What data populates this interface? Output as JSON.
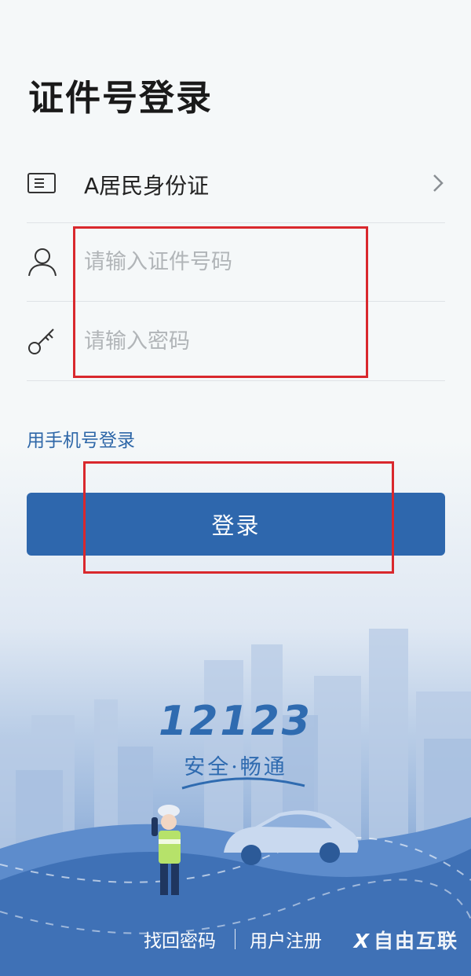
{
  "title": "证件号登录",
  "id_type": {
    "label": "A居民身份证"
  },
  "id_number": {
    "placeholder": "请输入证件号码"
  },
  "password": {
    "placeholder": "请输入密码"
  },
  "phone_login_link": "用手机号登录",
  "login_button": "登录",
  "brand": {
    "number": "12123",
    "slogan": "安全·畅通"
  },
  "footer": {
    "forgot_password": "找回密码",
    "register": "用户注册"
  },
  "watermark": {
    "symbol": "X",
    "text": "自由互联"
  },
  "icons": {
    "id_card": "id-card-icon",
    "user": "user-icon",
    "key": "key-icon",
    "chevron": "chevron-right-icon"
  },
  "colors": {
    "accent": "#2e67ad",
    "link": "#2e67a8",
    "highlight_box": "#d9282d",
    "background": "#f5f8f9"
  }
}
